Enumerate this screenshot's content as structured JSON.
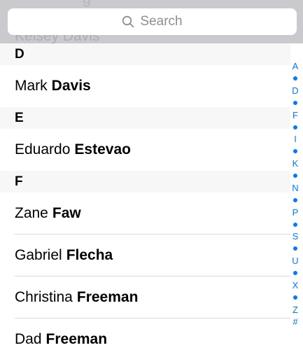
{
  "search": {
    "placeholder": "Search",
    "ghost_name": "Kelsey Davis",
    "ghost_top": "g"
  },
  "sections": [
    {
      "header": "D",
      "rows": [
        {
          "first": "Mark",
          "last": "Davis"
        }
      ]
    },
    {
      "header": "E",
      "rows": [
        {
          "first": "Eduardo",
          "last": "Estevao"
        }
      ]
    },
    {
      "header": "F",
      "rows": [
        {
          "first": "Zane",
          "last": "Faw"
        },
        {
          "first": "Gabriel",
          "last": "Flecha"
        },
        {
          "first": "Christina",
          "last": "Freeman"
        },
        {
          "first": "Dad",
          "last": "Freeman"
        }
      ]
    }
  ],
  "index_bar": [
    "A",
    "•",
    "D",
    "•",
    "F",
    "•",
    "I",
    "•",
    "K",
    "•",
    "N",
    "•",
    "P",
    "•",
    "S",
    "•",
    "U",
    "•",
    "X",
    "•",
    "Z",
    "#"
  ],
  "colors": {
    "accent": "#007aff",
    "search_bg": "#c9c9ce",
    "section_bg": "#f7f7f7"
  }
}
